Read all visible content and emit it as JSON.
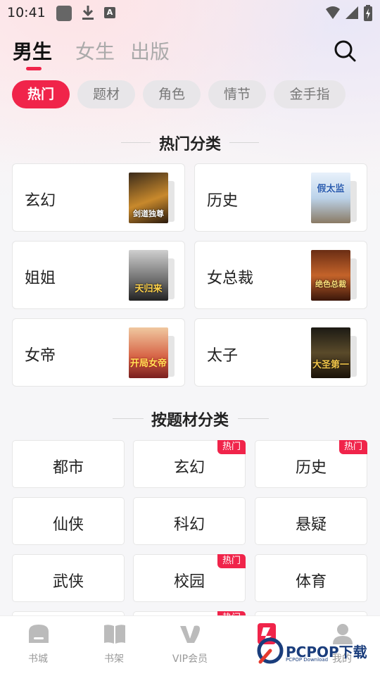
{
  "status_bar": {
    "time": "10:41",
    "icons": [
      "app-square-icon",
      "download-icon",
      "font-a-icon",
      "wifi-icon",
      "signal-icon",
      "battery-charging-icon"
    ],
    "a_glyph": "A"
  },
  "gender_tabs": [
    {
      "label": "男生",
      "active": true
    },
    {
      "label": "女生",
      "active": false
    },
    {
      "label": "出版",
      "active": false
    }
  ],
  "search_icon": "search-icon",
  "filter_chips": [
    {
      "label": "热门",
      "active": true
    },
    {
      "label": "题材",
      "active": false
    },
    {
      "label": "角色",
      "active": false
    },
    {
      "label": "情节",
      "active": false
    },
    {
      "label": "金手指",
      "active": false
    }
  ],
  "hot_categories": {
    "title": "热门分类",
    "items": [
      {
        "label": "玄幻",
        "cover_text": "剑道独尊"
      },
      {
        "label": "历史",
        "cover_text": "假太监"
      },
      {
        "label": "姐姐",
        "cover_text": "天归来"
      },
      {
        "label": "女总裁",
        "cover_text": "绝色总裁"
      },
      {
        "label": "女帝",
        "cover_text": "开局女帝"
      },
      {
        "label": "太子",
        "cover_text": "大圣第一"
      }
    ]
  },
  "genre_categories": {
    "title": "按题材分类",
    "hot_badge": "热门",
    "items": [
      {
        "label": "都市",
        "hot": false
      },
      {
        "label": "玄幻",
        "hot": true
      },
      {
        "label": "历史",
        "hot": true
      },
      {
        "label": "仙侠",
        "hot": false
      },
      {
        "label": "科幻",
        "hot": false
      },
      {
        "label": "悬疑",
        "hot": false
      },
      {
        "label": "武侠",
        "hot": false
      },
      {
        "label": "校园",
        "hot": true
      },
      {
        "label": "体育",
        "hot": false
      }
    ]
  },
  "bottom_nav": [
    {
      "label": "书城",
      "icon": "bookstore-icon"
    },
    {
      "label": "书架",
      "icon": "bookshelf-icon"
    },
    {
      "label": "VIP会员",
      "icon": "vip-icon"
    },
    {
      "label": "",
      "icon": "category-icon"
    },
    {
      "label": "我的",
      "icon": "profile-icon"
    }
  ],
  "watermark": {
    "text": "PCPOP下载",
    "sub": "PCPOP Download"
  },
  "colors": {
    "accent": "#f0244a",
    "background": "#f6f6f8"
  }
}
